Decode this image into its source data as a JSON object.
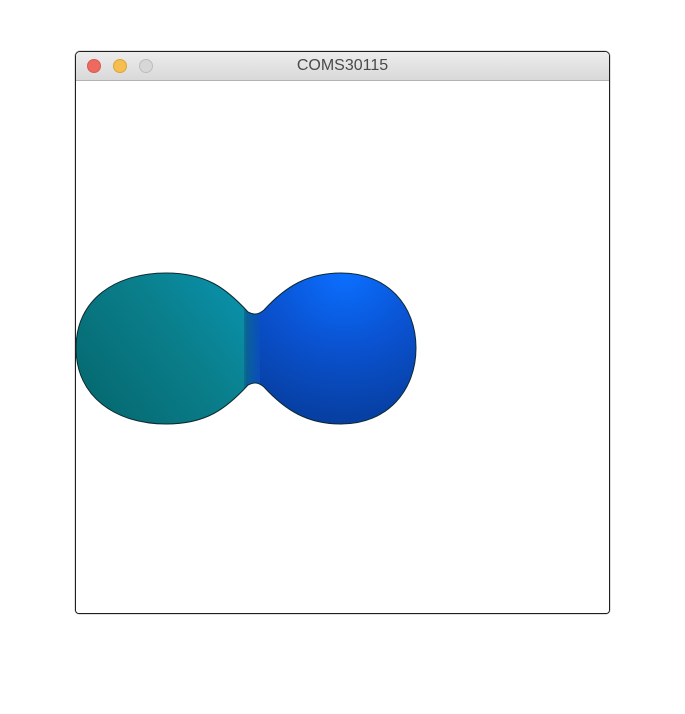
{
  "window": {
    "title": "COMS30115"
  },
  "titlebar_buttons": [
    {
      "name": "close",
      "color": "#ee6a5f"
    },
    {
      "name": "minimize",
      "color": "#f5be4f"
    },
    {
      "name": "zoom",
      "color": "#d7d7d7"
    }
  ],
  "scene": {
    "background": "#ffffff",
    "left_blob_color": "#0a8a94",
    "right_blob_color": "#0a5ee0"
  }
}
